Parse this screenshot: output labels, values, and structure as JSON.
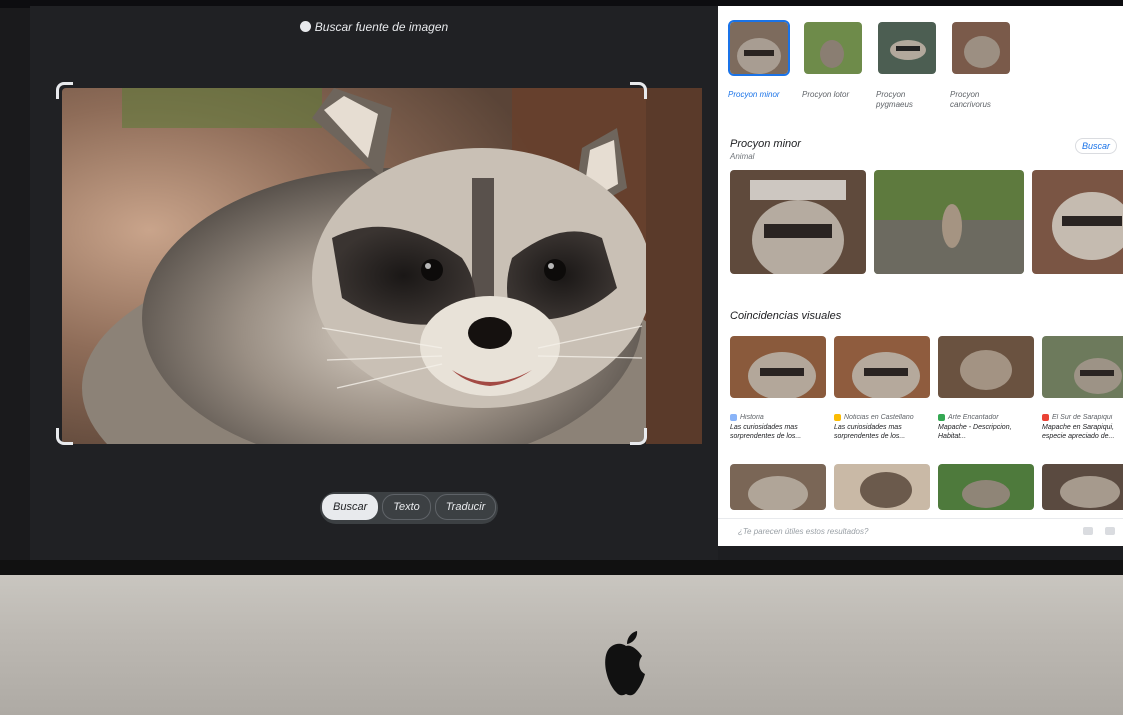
{
  "lens": {
    "header": "Buscar fuente de imagen",
    "modes": [
      {
        "label": "Buscar",
        "active": true
      },
      {
        "label": "Texto",
        "active": false
      },
      {
        "label": "Traducir",
        "active": false
      }
    ]
  },
  "results": {
    "chips": [
      {
        "label": "Procyon minor",
        "active": true
      },
      {
        "label": "Procyon lotor",
        "active": false
      },
      {
        "label": "Procyon pygmaeus",
        "active": false
      },
      {
        "label": "Procyon cancrivorus",
        "active": false
      }
    ],
    "entity_title": "Procyon minor",
    "entity_sub": "Animal",
    "search_link": "Buscar",
    "visual_title": "Coincidencias visuales",
    "visual_matches": [
      {
        "source": "Historia",
        "title": "Las curiosidades mas sorprendentes de los..."
      },
      {
        "source": "Noticias en Castellano",
        "title": "Las curiosidades mas sorprendentes de los..."
      },
      {
        "source": "Arte Encantador",
        "title": "Mapache - Descripcion, Habitat..."
      },
      {
        "source": "El Sur de Sarapiqui",
        "title": "Mapache en Sarapiqui, especie apreciado de..."
      }
    ],
    "feedback": "¿Te parecen útiles estos resultados?"
  },
  "colors": {
    "accent": "#1a73e8",
    "panel_dark": "#202124"
  }
}
